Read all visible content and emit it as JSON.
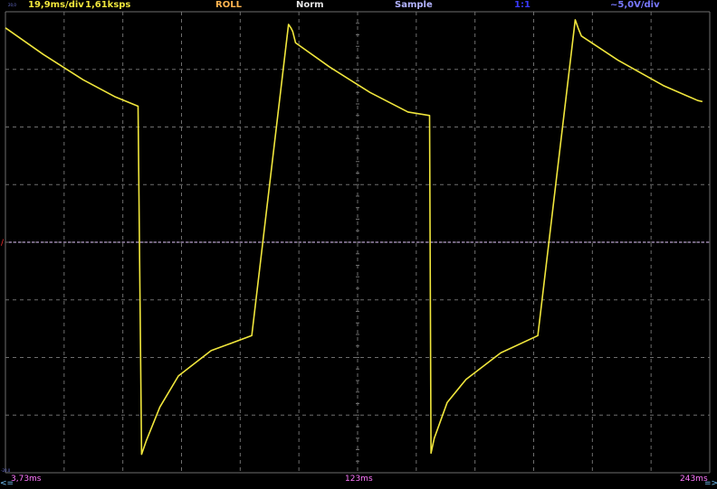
{
  "status": {
    "timebase": "19,9ms/div",
    "sample_rate": "1,61ksps",
    "mode": "ROLL",
    "trigger": "Norm",
    "acquisition": "Sample",
    "probe": "1:1",
    "volts_div": "~5,0V/div"
  },
  "colors": {
    "trace": "#f0e63c",
    "timebase": "#f0e63c",
    "mode": "#ffb450",
    "trigger": "#e6e6e6",
    "acquisition": "#b4b4ff",
    "probe": "#3a3aff",
    "volts": "#7878ff",
    "time_label": "#ff78ff",
    "scroll_arrow": "#78c8ff",
    "grid": "#6e6e6e",
    "trigger_line": "#e6c8ff"
  },
  "scale": {
    "top": "20,0",
    "bottom": "-20,0"
  },
  "axis": {
    "left_arrow": "<=",
    "left_time": "3,73ms",
    "mid_time": "123ms",
    "right_time": "243ms",
    "right_arrow": "=>"
  },
  "chart_data": {
    "type": "line",
    "title": "",
    "xlabel": "",
    "ylabel": "",
    "x_unit": "ms",
    "y_unit": "V",
    "xlim": [
      3.73,
      243
    ],
    "ylim": [
      -20,
      20
    ],
    "grid": true,
    "trigger_level": 0,
    "series": [
      {
        "x": [
          3.73,
          16.6,
          30.1,
          41.1,
          48.8,
          50.0,
          51.6,
          56.2,
          62.5,
          73.6,
          87.4,
          99.9,
          100.7,
          101.3,
          102.3,
          113.9,
          127.6,
          140.5,
          147.8,
          148.3,
          149.4,
          153.8,
          160.2,
          172.0,
          184.6,
          197.3,
          198.4,
          199.4,
          211.8,
          227.2,
          238.9,
          240.5
        ],
        "y": [
          18.6,
          16.3,
          14.1,
          12.6,
          11.8,
          -18.4,
          -17.2,
          -14.3,
          -11.6,
          -9.4,
          -8.1,
          18.9,
          18.6,
          18.3,
          17.3,
          15.2,
          13.0,
          11.3,
          11.0,
          -18.3,
          -17.0,
          -13.9,
          -11.9,
          -9.6,
          -8.1,
          19.3,
          18.5,
          17.9,
          15.8,
          13.6,
          12.3,
          12.2
        ]
      }
    ]
  }
}
